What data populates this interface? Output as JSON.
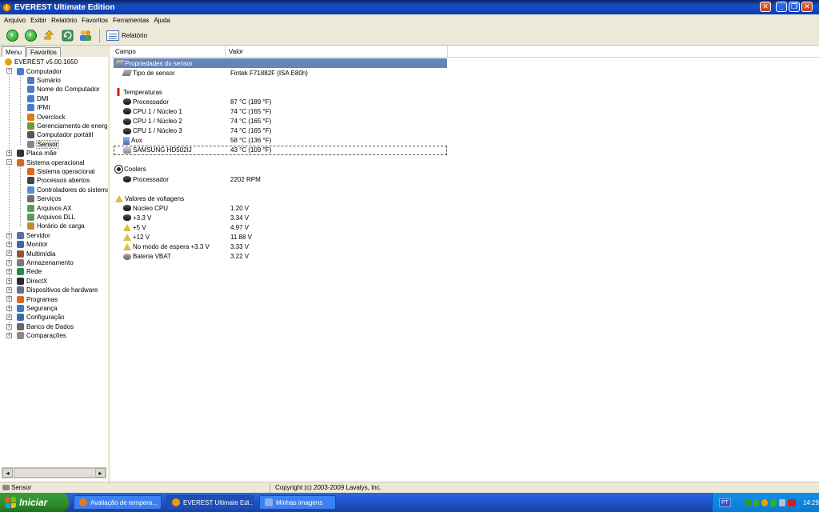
{
  "window": {
    "title": "EVEREST Ultimate Edition"
  },
  "menu": [
    "Arquivo",
    "Exibir",
    "Relatório",
    "Favoritos",
    "Ferramentas",
    "Ajuda"
  ],
  "toolbar": {
    "report_label": "Relatório"
  },
  "left_tabs": [
    "Menu",
    "Favoritos"
  ],
  "tree": [
    {
      "label": "EVEREST v5.00.1650",
      "icon": "info-icon",
      "depth": 0,
      "expander": "",
      "color": "#e8a000"
    },
    {
      "label": "Computador",
      "icon": "computer-icon",
      "depth": 1,
      "expander": "−",
      "color": "#4a7dc9"
    },
    {
      "label": "Sumário",
      "icon": "computer-icon",
      "depth": 2,
      "expander": "",
      "color": "#4a7dc9"
    },
    {
      "label": "Nome do Computador",
      "icon": "computer-icon",
      "depth": 2,
      "expander": "",
      "color": "#4a7dc9"
    },
    {
      "label": "DMI",
      "icon": "computer-icon",
      "depth": 2,
      "expander": "",
      "color": "#4a7dc9"
    },
    {
      "label": "IPMI",
      "icon": "computer-icon",
      "depth": 2,
      "expander": "",
      "color": "#4a7dc9"
    },
    {
      "label": "Overclock",
      "icon": "flame-icon",
      "depth": 2,
      "expander": "",
      "color": "#e07a10"
    },
    {
      "label": "Gerenciamento de energia",
      "icon": "power-icon",
      "depth": 2,
      "expander": "",
      "color": "#6a9a3a"
    },
    {
      "label": "Computador portátil",
      "icon": "laptop-icon",
      "depth": 2,
      "expander": "",
      "color": "#555555"
    },
    {
      "label": "Sensor",
      "icon": "sensor-icon",
      "depth": 2,
      "expander": "",
      "color": "#888888",
      "selected": true
    },
    {
      "label": "Placa mãe",
      "icon": "motherboard-icon",
      "depth": 1,
      "expander": "+",
      "color": "#333333"
    },
    {
      "label": "Sistema operacional",
      "icon": "windows-icon",
      "depth": 1,
      "expander": "−",
      "color": "#d86a20"
    },
    {
      "label": "Sistema operacional",
      "icon": "windows-icon",
      "depth": 2,
      "expander": "",
      "color": "#d86a20"
    },
    {
      "label": "Processos abertos",
      "icon": "process-icon",
      "depth": 2,
      "expander": "",
      "color": "#444444"
    },
    {
      "label": "Controladores do sistema",
      "icon": "driver-icon",
      "depth": 2,
      "expander": "",
      "color": "#5a8fd0"
    },
    {
      "label": "Serviços",
      "icon": "gears-icon",
      "depth": 2,
      "expander": "",
      "color": "#707070"
    },
    {
      "label": "Arquivos AX",
      "icon": "file-icon",
      "depth": 2,
      "expander": "",
      "color": "#5a9a5a"
    },
    {
      "label": "Arquivos DLL",
      "icon": "file-icon",
      "depth": 2,
      "expander": "",
      "color": "#5a9a5a"
    },
    {
      "label": "Horário de carga",
      "icon": "clock-icon",
      "depth": 2,
      "expander": "",
      "color": "#c08a3a"
    },
    {
      "label": "Servidor",
      "icon": "server-icon",
      "depth": 1,
      "expander": "+",
      "color": "#5a6fa0"
    },
    {
      "label": "Monitor",
      "icon": "monitor-icon",
      "depth": 1,
      "expander": "+",
      "color": "#3a6ab0"
    },
    {
      "label": "Multimídia",
      "icon": "multimedia-icon",
      "depth": 1,
      "expander": "+",
      "color": "#8a5a3a"
    },
    {
      "label": "Armazenamento",
      "icon": "storage-icon",
      "depth": 1,
      "expander": "+",
      "color": "#7a7a7a"
    },
    {
      "label": "Rede",
      "icon": "network-icon",
      "depth": 1,
      "expander": "+",
      "color": "#2a8a4a"
    },
    {
      "label": "DirectX",
      "icon": "directx-icon",
      "depth": 1,
      "expander": "+",
      "color": "#2a2a2a"
    },
    {
      "label": "Dispositivos de hardware",
      "icon": "device-icon",
      "depth": 1,
      "expander": "+",
      "color": "#6a6a8a"
    },
    {
      "label": "Programas",
      "icon": "programs-icon",
      "depth": 1,
      "expander": "+",
      "color": "#d86a20"
    },
    {
      "label": "Segurança",
      "icon": "shield-icon",
      "depth": 1,
      "expander": "+",
      "color": "#3a7ac8"
    },
    {
      "label": "Configuração",
      "icon": "config-icon",
      "depth": 1,
      "expander": "+",
      "color": "#3a6ab0"
    },
    {
      "label": "Banco de Dados",
      "icon": "database-icon",
      "depth": 1,
      "expander": "+",
      "color": "#6a6a6a"
    },
    {
      "label": "Comparações",
      "icon": "compare-icon",
      "depth": 1,
      "expander": "+",
      "color": "#8a8a8a"
    }
  ],
  "columns": {
    "field": "Campo",
    "value": "Valor"
  },
  "rows": [
    {
      "type": "group",
      "field": "Propriedades do sensor",
      "value": "",
      "icon": "sensor-icon",
      "highlight": true
    },
    {
      "type": "item",
      "field": "Tipo de sensor",
      "value": "Fintek F71882F  (ISA E80h)",
      "icon": "sensor-icon"
    },
    {
      "type": "spacer"
    },
    {
      "type": "group",
      "field": "Temperaturas",
      "value": "",
      "icon": "thermometer-icon"
    },
    {
      "type": "item",
      "field": "Processador",
      "value": "87 °C  (189 °F)",
      "icon": "cpu-icon"
    },
    {
      "type": "item",
      "field": "CPU 1 / Núcleo 1",
      "value": "74 °C  (165 °F)",
      "icon": "cpu-icon"
    },
    {
      "type": "item",
      "field": "CPU 1 / Núcleo 2",
      "value": "74 °C  (165 °F)",
      "icon": "cpu-icon"
    },
    {
      "type": "item",
      "field": "CPU 1 / Núcleo 3",
      "value": "74 °C  (165 °F)",
      "icon": "cpu-icon"
    },
    {
      "type": "item",
      "field": "Aux",
      "value": "58 °C  (136 °F)",
      "icon": "computer-icon"
    },
    {
      "type": "item",
      "field": "SAMSUNG HD502IJ",
      "value": "43 °C  (109 °F)",
      "icon": "harddisk-icon",
      "focused": true
    },
    {
      "type": "spacer"
    },
    {
      "type": "group",
      "field": "Coolers",
      "value": "",
      "icon": "fan-icon"
    },
    {
      "type": "item",
      "field": "Processador",
      "value": "2202 RPM",
      "icon": "cpu-icon"
    },
    {
      "type": "spacer"
    },
    {
      "type": "group",
      "field": "Valores de voltagens",
      "value": "",
      "icon": "voltage-icon"
    },
    {
      "type": "item",
      "field": "Núcleo CPU",
      "value": "1.20 V",
      "icon": "cpu-icon"
    },
    {
      "type": "item",
      "field": "+3.3 V",
      "value": "3.34 V",
      "icon": "cpu-icon"
    },
    {
      "type": "item",
      "field": "+5 V",
      "value": "4.97 V",
      "icon": "voltage-icon"
    },
    {
      "type": "item",
      "field": "+12 V",
      "value": "11.88 V",
      "icon": "voltage-icon"
    },
    {
      "type": "item",
      "field": "No modo de espera +3.3 V",
      "value": "3.33 V",
      "icon": "voltage-icon"
    },
    {
      "type": "item",
      "field": "Bateria VBAT",
      "value": "3.22 V",
      "icon": "battery-icon"
    }
  ],
  "status": {
    "left": "Sensor",
    "right": "Copyright (c) 2003-2009 Lavalys, Inc."
  },
  "taskbar": {
    "start": "Iniciar",
    "items": [
      {
        "label": "Avaliação de tempera...",
        "icon": "firefox-icon",
        "color": "#e07a20",
        "active": false
      },
      {
        "label": "EVEREST Ultimate Edi...",
        "icon": "everest-icon",
        "color": "#e8a000",
        "active": true
      },
      {
        "label": "Minhas imagens",
        "icon": "folder-icon",
        "color": "#8ab0e8",
        "active": false
      }
    ],
    "lang": "PT",
    "clock": "14:29"
  }
}
